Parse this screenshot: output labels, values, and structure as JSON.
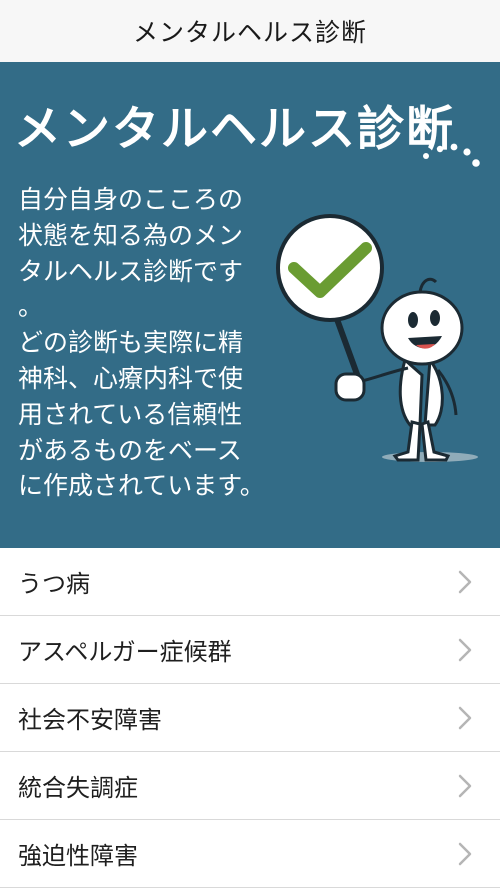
{
  "navbar": {
    "title": "メンタルヘルス診断"
  },
  "hero": {
    "title": "メンタルヘルス診断",
    "description_lines": [
      "自分自身のこころの",
      "状態を知る為のメン",
      "タルヘルス診断です",
      "。",
      "どの診断も実際に精",
      "神科、心療内科で使",
      "用されている信頼性",
      "があるものをベース",
      "に作成されています。"
    ],
    "background_color": "#336c87",
    "illustration": "mascot-holding-checkmark-sign"
  },
  "menu": {
    "items": [
      {
        "label": "うつ病",
        "icon": "chevron-right-icon"
      },
      {
        "label": "アスペルガー症候群",
        "icon": "chevron-right-icon"
      },
      {
        "label": "社会不安障害",
        "icon": "chevron-right-icon"
      },
      {
        "label": "統合失調症",
        "icon": "chevron-right-icon"
      },
      {
        "label": "強迫性障害",
        "icon": "chevron-right-icon"
      }
    ]
  }
}
